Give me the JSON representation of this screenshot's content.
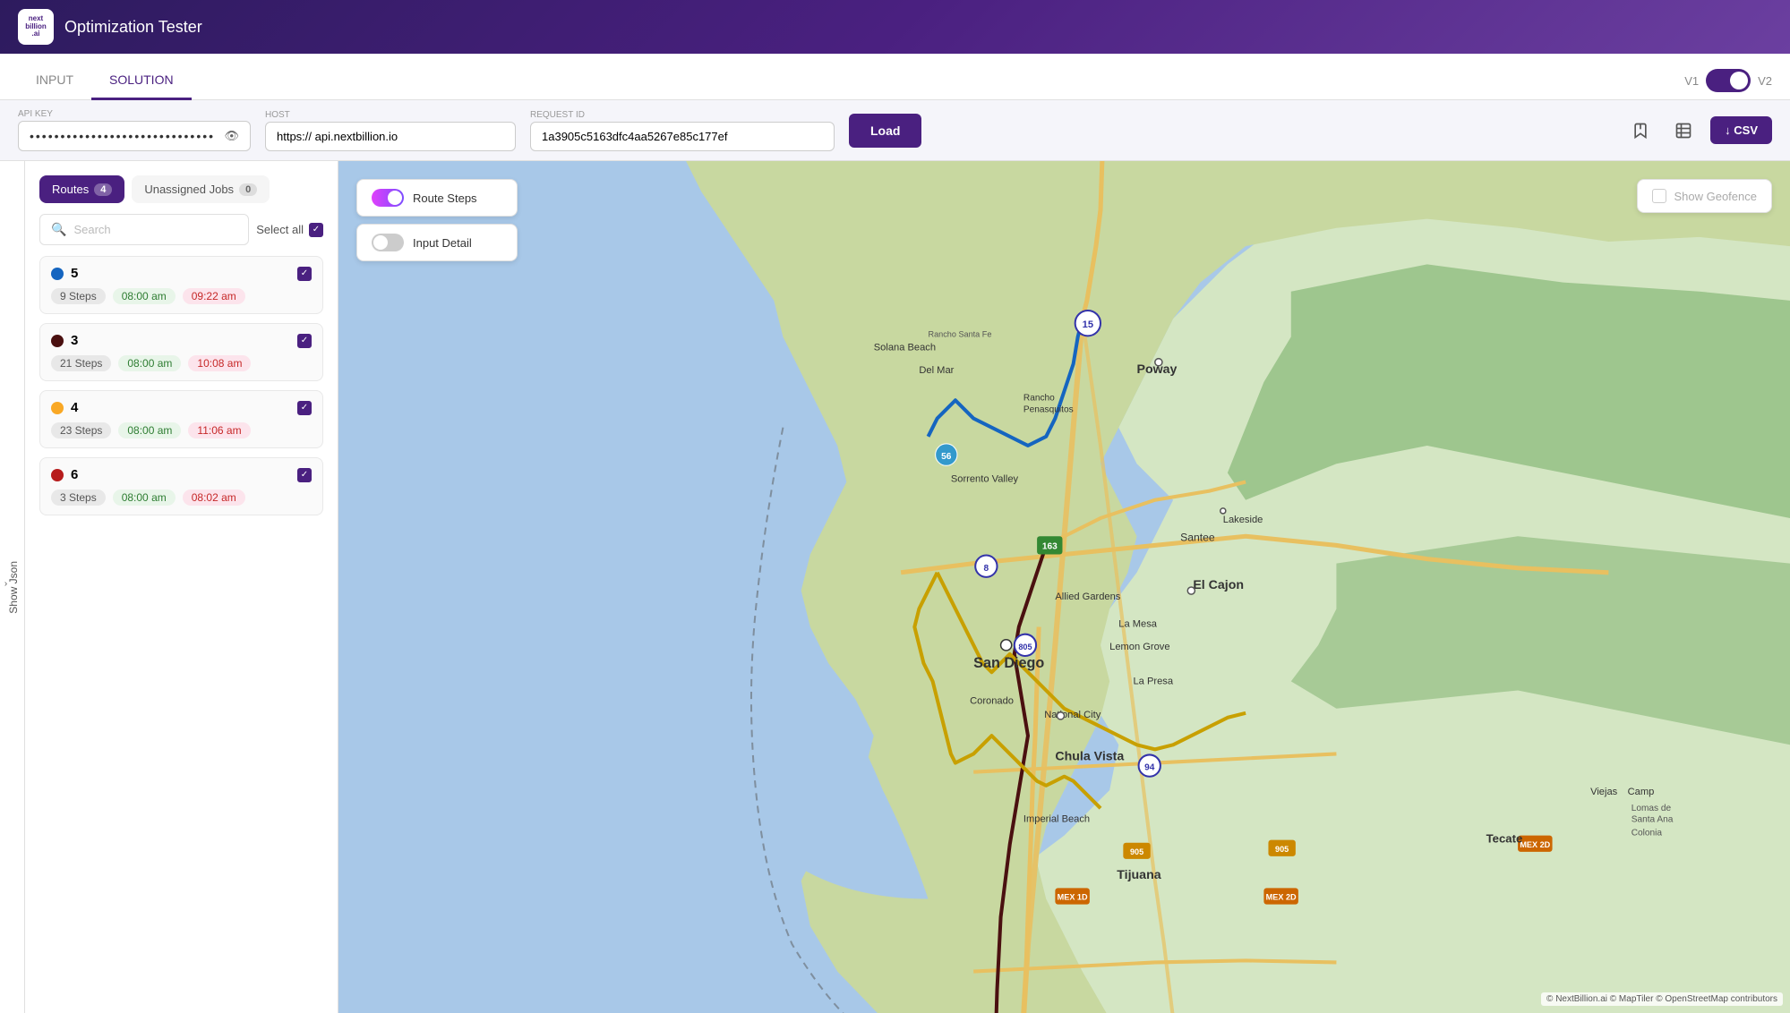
{
  "app": {
    "title": "Optimization Tester",
    "logo_text": "next\nbillion\n.ai"
  },
  "tabs": {
    "input": "INPUT",
    "solution": "SOLUTION",
    "active": "solution"
  },
  "version": {
    "v1": "V1",
    "v2": "V2"
  },
  "toolbar": {
    "api_key_label": "API key",
    "api_key_value": "••••••••••••••••••••••••••••••",
    "host_label": "Host",
    "host_value": "https://  api.nextbillion.io",
    "request_id_label": "Request ID",
    "request_id_value": "1a3905c5163dfc4aa5267e85c177ef",
    "load_button": "Load",
    "csv_button": "↓  CSV"
  },
  "show_json": "Show Json",
  "panel": {
    "routes_tab": "Routes",
    "routes_count": "4",
    "unassigned_tab": "Unassigned Jobs",
    "unassigned_count": "0",
    "search_placeholder": "Search",
    "select_all": "Select all"
  },
  "routes": [
    {
      "id": "5",
      "color": "#1565c0",
      "steps": "9 Steps",
      "start_time": "08:00 am",
      "end_time": "09:22 am",
      "checked": true
    },
    {
      "id": "3",
      "color": "#4a1010",
      "steps": "21 Steps",
      "start_time": "08:00 am",
      "end_time": "10:08 am",
      "checked": true
    },
    {
      "id": "4",
      "color": "#f9a825",
      "steps": "23 Steps",
      "start_time": "08:00 am",
      "end_time": "11:06 am",
      "checked": true
    },
    {
      "id": "6",
      "color": "#b71c1c",
      "steps": "3 Steps",
      "start_time": "08:00 am",
      "end_time": "08:02 am",
      "checked": true
    }
  ],
  "map_overlays": {
    "route_steps": "Route Steps",
    "route_steps_on": true,
    "input_detail": "Input Detail",
    "input_detail_on": false,
    "show_geofence": "Show Geofence"
  },
  "attribution": "© NextBillion.ai © MapTiler © OpenStreetMap contributors"
}
